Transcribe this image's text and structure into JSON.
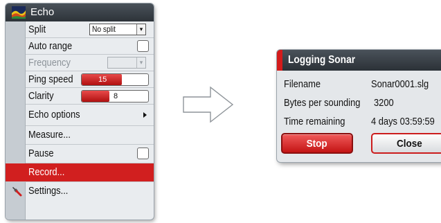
{
  "menu": {
    "title": "Echo",
    "items": [
      {
        "label": "Split",
        "control": "dropdown",
        "value": "No split"
      },
      {
        "label": "Auto range",
        "control": "checkbox",
        "checked": false
      },
      {
        "label": "Frequency",
        "control": "dropdown",
        "value": "",
        "disabled": true
      },
      {
        "label": "Ping speed",
        "control": "slider",
        "value": "15"
      },
      {
        "label": "Clarity",
        "control": "slider",
        "value": "8"
      },
      {
        "label": "Echo options",
        "control": "submenu"
      },
      {
        "label": "Measure..."
      },
      {
        "label": "Pause",
        "control": "checkbox",
        "checked": false
      },
      {
        "label": "Record...",
        "selected": true
      },
      {
        "label": "Settings...",
        "icon": "wrench-icon"
      }
    ]
  },
  "dialog": {
    "title": "Logging Sonar",
    "fields": [
      {
        "label": "Filename",
        "value": "Sonar0001.slg"
      },
      {
        "label": "Bytes per sounding",
        "value": "3200"
      },
      {
        "label": "Time remaining",
        "value": "4 days 03:59:59"
      }
    ],
    "stop_label": "Stop",
    "close_label": "Close"
  },
  "colors": {
    "accent_red": "#d11f1f",
    "title_bar": "#363c42",
    "panel": "#e9ecef"
  },
  "icons": {
    "menu": "echo-icon",
    "settings": "wrench-icon",
    "flow": "right-arrow-icon"
  }
}
